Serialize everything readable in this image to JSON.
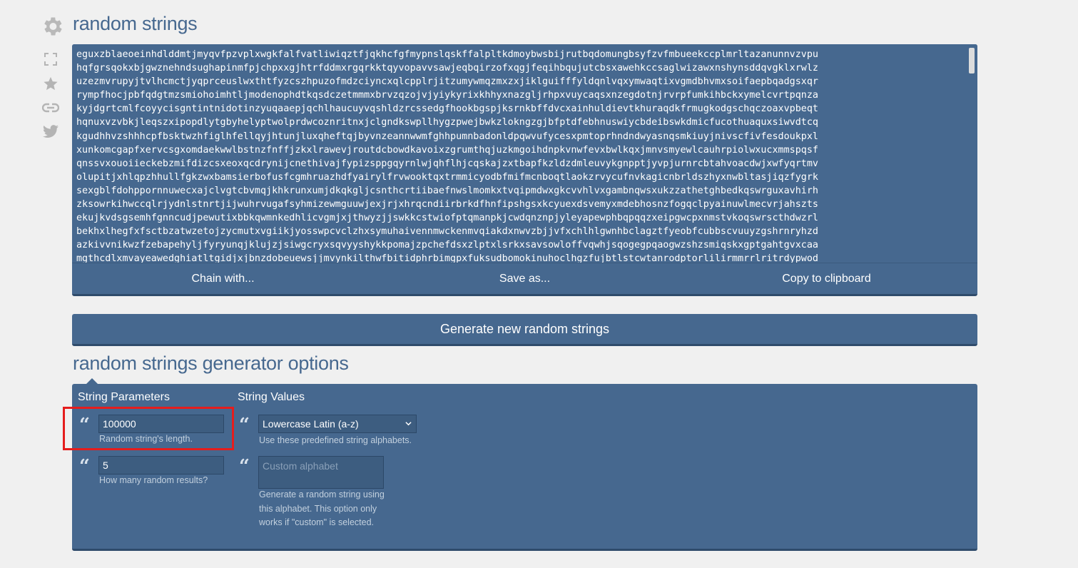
{
  "page": {
    "title": "random strings",
    "options_title": "random strings generator options"
  },
  "side_icons": [
    "gear-icon",
    "fullscreen-icon",
    "star-icon",
    "link-icon",
    "twitter-icon"
  ],
  "output": {
    "lines": [
      "eguxzblaeoeinhdlddmtjmyqvfpzvplxwgkfalfvatliwiqztfjqkhcfgfmypnslqskffalpltkdmoybwsbijrutbqdomungbsyfzvfmbueekccplmrltazanunnvzvpu",
      "hqfgrsqokxbjgwznehndsughapinmfpjchpxxgjhtrfddmxrgqrkktqyvopavvsawjeqbqirzofxqgjfeqihbqujutcbsxawehkccsaglwizawxnshynsddqvgklxrwlz",
      "uzezmvrupyjtvlhcmctjyqprceuslwxthtfyzcszhpuzofmdzciyncxqlcpplrjitzumywmqzmxzxjiklguifffyldqnlvqxymwaqtixvgmdbhvmxsoifaepbqadgsxqr",
      "rympfhocjpbfqdgtmzsmiohoimhtljmodenophdtkqsdczetmmmxbrvzqzojvjyiykyrixkhhyxnazgljrhpxvuycaqsxnzegdotnjrvrpfumkihbckxymelcvrtpqnza",
      "kyjdgrtcmlfcoyycisgntintnidotinzyuqaaepjqchlhaucuyvqshldzrcssedgfhookbgspjksrnkbffdvcxainhuldievtkhuraqdkfrmugkodgschqczoaxvpbeqt",
      "hqnuxvzvbkjleqszxipopdlytgbyhelyptwolprdwcoznritnxjclgndkswpllhygzpwejbwkzlokngzgjbfptdfebhnuswiycbdeibswkdmicfucothuaquxsiwvdtcq",
      "kgudhhvzshhhcpfbsktwzhfiglhfellqyjhtunjluxqheftqjbyvnzeannwwmfghhpumnbadonldpqwvufycesxpmtoprhndndwyasnqsmkiuyjnivscfivfesdoukpxl",
      "xunkomcgapfxervcsgxomdaekwwlbstnzfnffjzkxlrawevjroutdcbowdkavoixzgrumthqjuzkmgoihdnpkvnwfevxbwlkqxjmnvsmyewlcauhrpiolwxucxmmspqsf",
      "qnssvxouoiieckebzmifdizcsxeoxqcdrynijcnethivajfypizsppgqyrnlwjqhflhjcqskajzxtbapfkzldzdmleuvykgnpptjyvpjurnrcbtahvoacdwjxwfyqrtmv",
      "olupitjxhlqpzhhullfgkzwxbamsierbofusfcgmhruazhdfyairylfrvwooktqxtrmmicyodbfmifmcnboqtlaokzrvycufnvkagicnbrldszhyxnwbltasjiqzfygrk",
      "sexgblfdohppornnuwecxajclvgtcbvmqjkhkrunxumjdkqkgljcsnthcrtiibaefnwslmomkxtvqipmdwxgkcvvhlvxgambnqwsxukzzathetghbedkqswrguxavhirh",
      "zksowrkihwccqlrjydnlstnrtjijwuhrvugafsyhmizewmguuwjexjrjxhrqcndiirbrkdfhnfipshgsxkcyuexdsvemyxmdebhosnzfogqclpyainuwlmecvrjahszts",
      "ekujkvdsgsemhfgnncudjpewutixbbkqwmnkedhlicvgmjxjthwyzjjswkkcstwiofptqmanpkjcwdqnznpjyleyapewphbqpqqzxeipgwcpxnmstvkoqswrscthdwzrl",
      "bekhxlhegfxfsctbzatwzetojzycmutxvgiikjyosswpcvclzhxsymuhaivennmwckenmvqiakdxnwvzbjjvfxchlhlgwnhbclagztfyeobfcubbscvuuyzgshrnryhzd",
      "azkivvnikwzfzebapehyljfyryunqjklujzjsiwgcryxsqvyyshykkpomajzpchefdsxzlptxlsrkxsavsowloffvqwhjsqogegpqaogwzshzsmiqskxgptgahtgvxcaa",
      "mgthcdlxmvayeawedghiatltgidjxjbnzdobeuewsjjmvynkilthwfbitidphrbimgpxfuksudbomokinuhoclhgzfujbtlstcwtanrodptorlilirmmrrlritrdypwod"
    ]
  },
  "actions": {
    "chain": "Chain with...",
    "save": "Save as...",
    "copy": "Copy to clipboard"
  },
  "generate_button": "Generate new random strings",
  "options": {
    "col1_header": "String Parameters",
    "col2_header": "String Values",
    "length_value": "100000",
    "length_hint": "Random string's length.",
    "count_value": "5",
    "count_hint": "How many random results?",
    "alphabet_selected": "Lowercase Latin (a-z)",
    "alphabet_hint": "Use these predefined string alphabets.",
    "custom_placeholder": "Custom alphabet",
    "custom_hint_1": "Generate a random string using",
    "custom_hint_2": "this alphabet. This option only",
    "custom_hint_3": "works if \"custom\" is selected."
  },
  "colors": {
    "panel": "#46688f",
    "heading": "#46688f",
    "highlight": "#e51d1d"
  }
}
